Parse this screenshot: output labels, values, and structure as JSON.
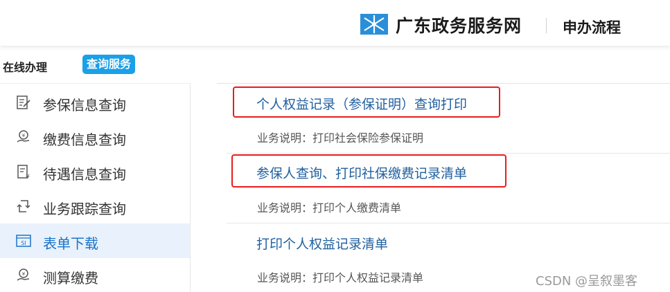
{
  "header": {
    "site_title": "广东政务服务网",
    "sub_title": "申办流程"
  },
  "tabs": {
    "online": "在线办理",
    "query": "查询服务"
  },
  "sidebar": {
    "items": [
      {
        "label": "参保信息查询"
      },
      {
        "label": "缴费信息查询"
      },
      {
        "label": "待遇信息查询"
      },
      {
        "label": "业务跟踪查询"
      },
      {
        "label": "表单下载"
      },
      {
        "label": "测算缴费"
      }
    ]
  },
  "services": [
    {
      "title": "个人权益记录（参保证明）查询打印",
      "desc": "业务说明：打印社会保险参保证明"
    },
    {
      "title": "参保人查询、打印社保缴费记录清单",
      "desc": "业务说明：打印个人缴费清单"
    },
    {
      "title": "打印个人权益记录清单",
      "desc": "业务说明：打印个人权益记录清单"
    }
  ],
  "watermark": "CSDN @呈叙墨客",
  "colors": {
    "accent": "#1aa0e8",
    "link": "#1f5f9f",
    "highlight_box": "#e81c1c",
    "active_bg": "#e9f2fc"
  }
}
